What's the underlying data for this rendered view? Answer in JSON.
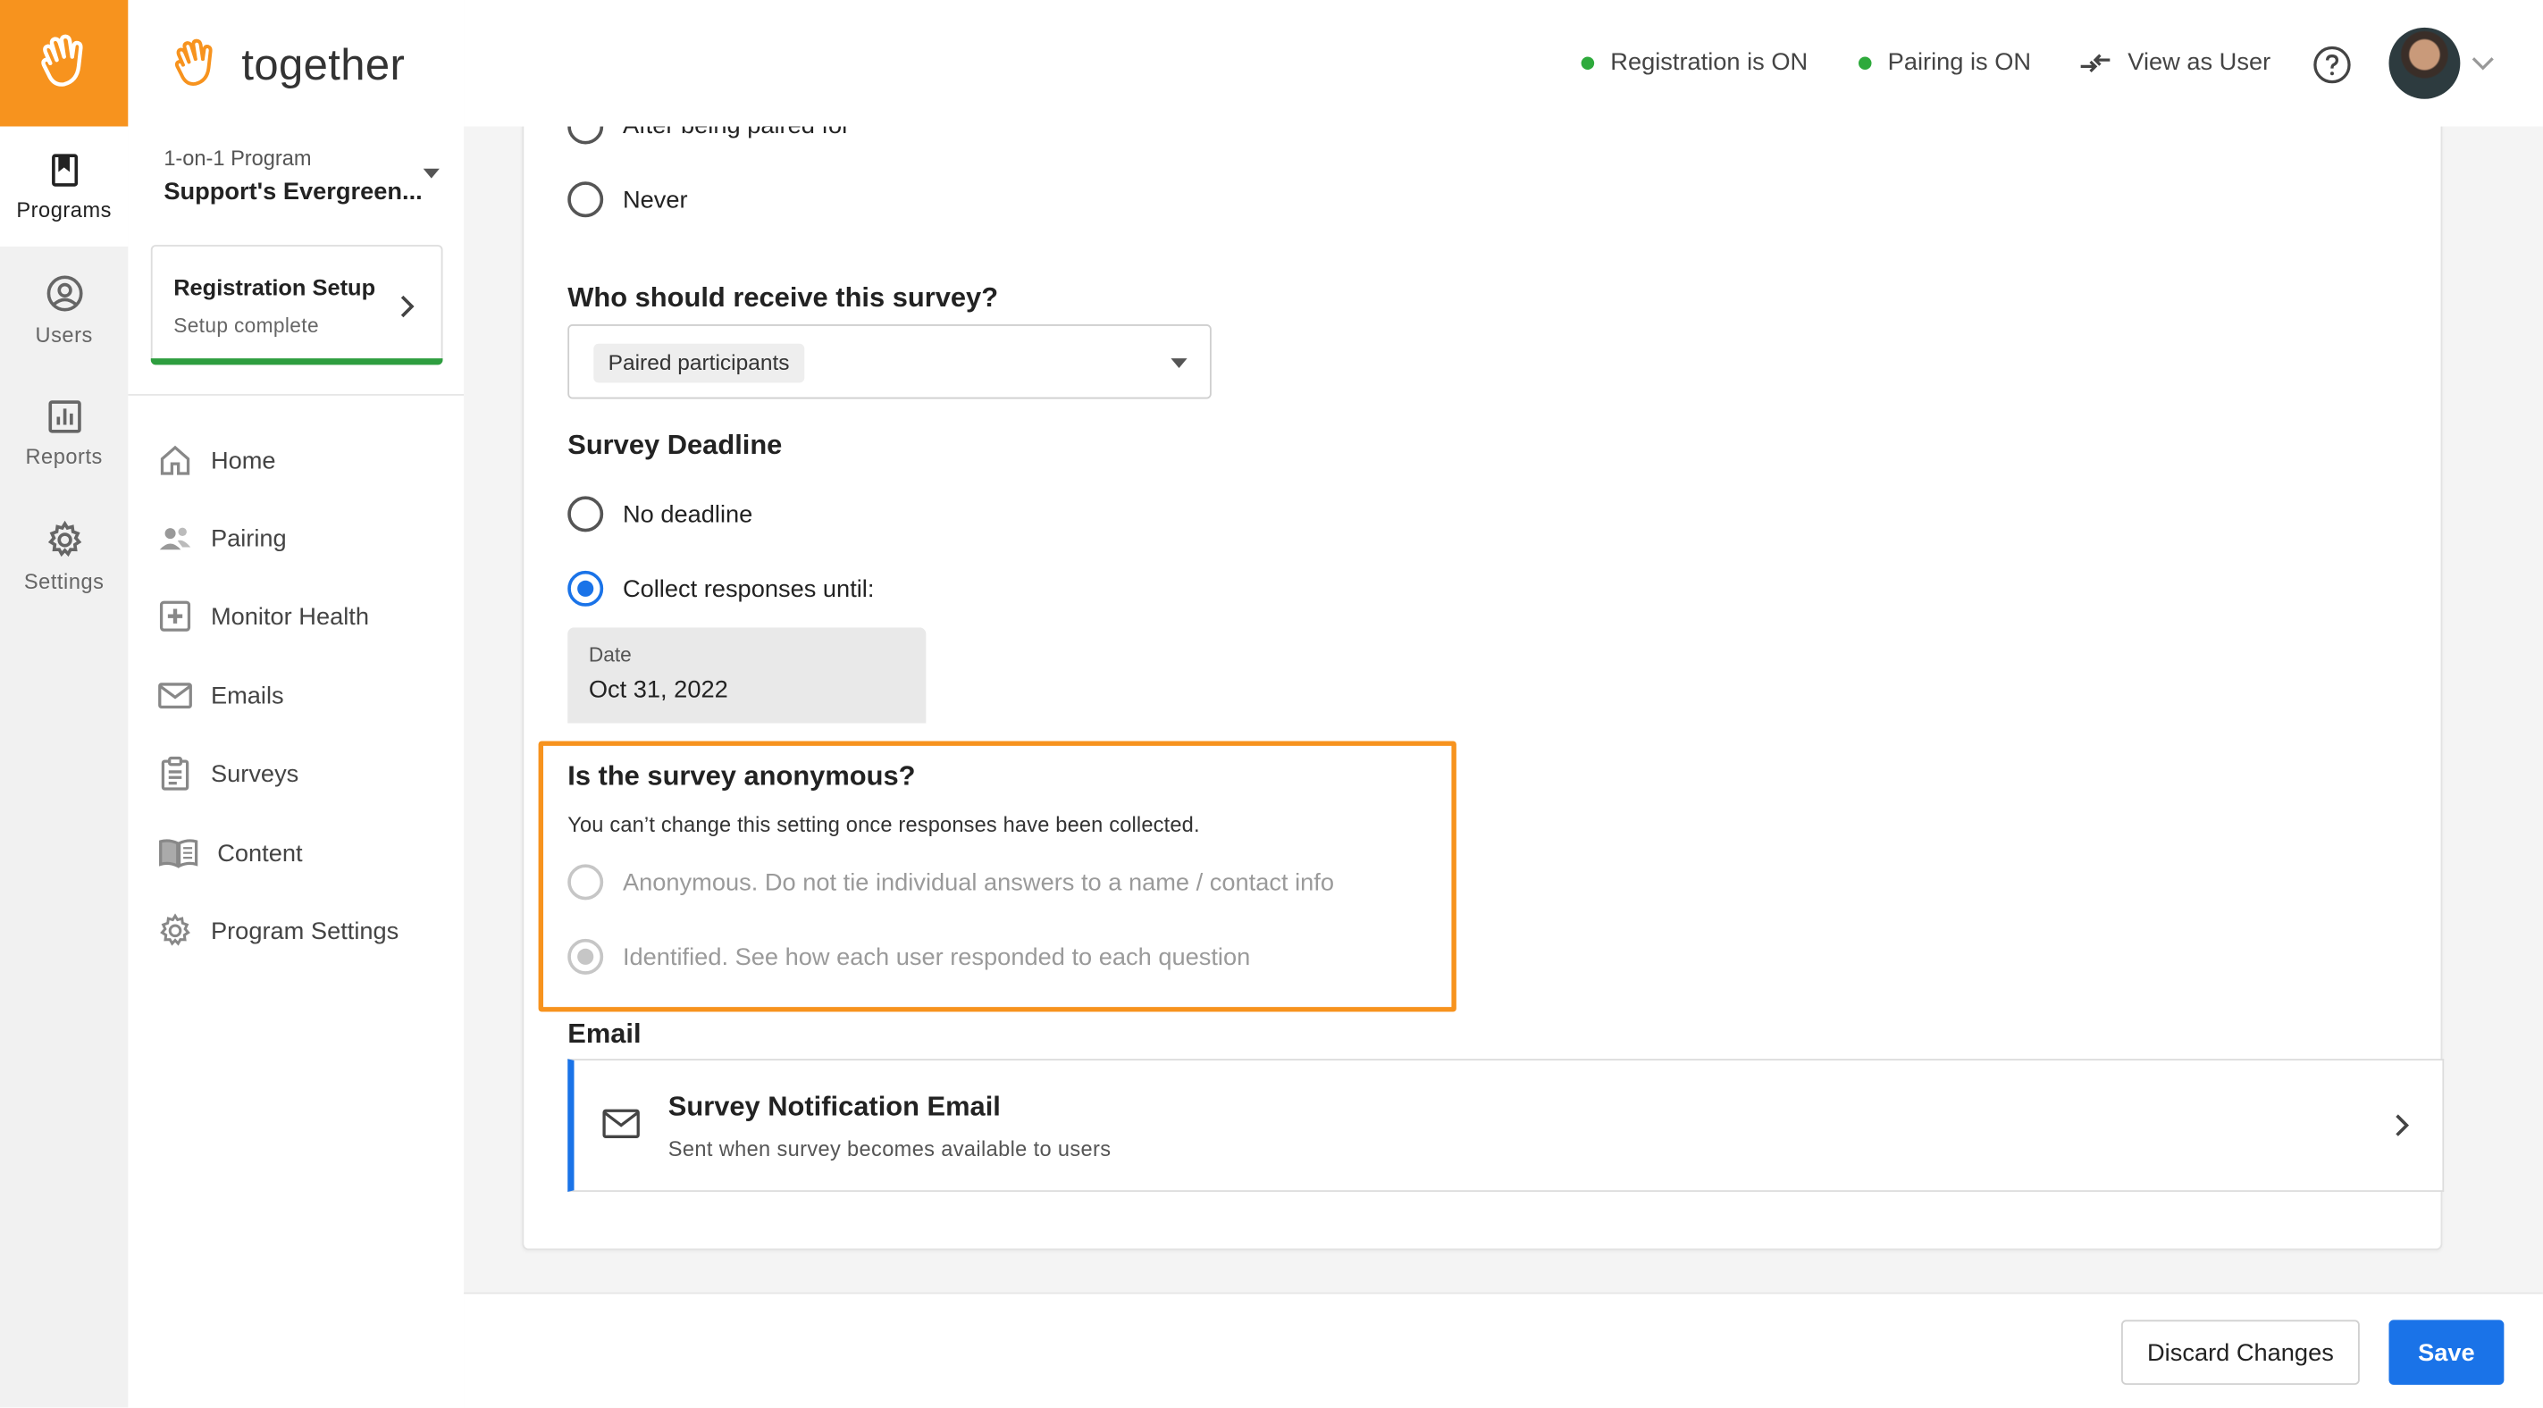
{
  "brand": {
    "name": "together",
    "accent": "#f7931e"
  },
  "rail": {
    "items": [
      {
        "label": "Programs",
        "icon": "bookmark-icon",
        "active": true
      },
      {
        "label": "Users",
        "icon": "user-circle-icon"
      },
      {
        "label": "Reports",
        "icon": "bar-chart-icon"
      },
      {
        "label": "Settings",
        "icon": "gear-icon"
      }
    ]
  },
  "program": {
    "type": "1-on-1 Program",
    "name": "Support's Evergreen..."
  },
  "setup": {
    "title": "Registration Setup",
    "status": "Setup complete"
  },
  "nav": {
    "items": [
      {
        "label": "Home",
        "icon": "home-icon"
      },
      {
        "label": "Pairing",
        "icon": "people-icon"
      },
      {
        "label": "Monitor Health",
        "icon": "plus-box-icon"
      },
      {
        "label": "Emails",
        "icon": "envelope-icon"
      },
      {
        "label": "Surveys",
        "icon": "clipboard-icon"
      },
      {
        "label": "Content",
        "icon": "book-icon"
      },
      {
        "label": "Program Settings",
        "icon": "gear-icon"
      }
    ]
  },
  "topbar": {
    "registration": "Registration is ON",
    "pairing": "Pairing is ON",
    "view_as_user": "View as User",
    "status_color": "#2eaa3c"
  },
  "form": {
    "partial_option": "After being paired for",
    "never_option": "Never",
    "recipients": {
      "heading": "Who should receive this survey?",
      "selected": "Paired participants"
    },
    "deadline": {
      "heading": "Survey Deadline",
      "no_deadline": "No deadline",
      "collect_until": "Collect responses until:",
      "date_label": "Date",
      "date_value": "Oct 31, 2022"
    },
    "anonymity": {
      "heading": "Is the survey anonymous?",
      "hint": "You can’t change this setting once responses have been collected.",
      "anonymous": "Anonymous. Do not tie individual answers to a name / contact info",
      "identified": "Identified. See how each user responded to each question"
    },
    "email": {
      "heading": "Email",
      "title": "Survey Notification Email",
      "subtitle": "Sent when survey becomes available to users"
    }
  },
  "footer": {
    "discard": "Discard Changes",
    "save": "Save"
  }
}
